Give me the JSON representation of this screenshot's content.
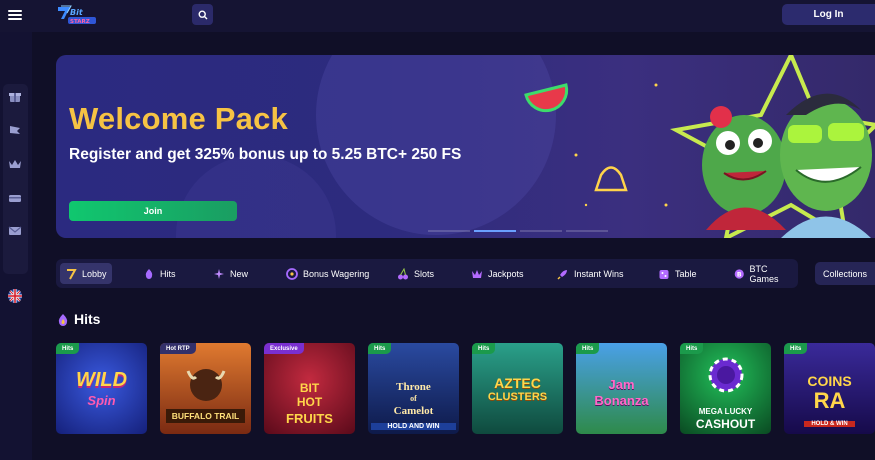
{
  "header": {
    "login_label": "Log In",
    "logo_alt": "Bit Starz logo"
  },
  "banner": {
    "title": "Welcome Pack",
    "subtitle": "Register and get 325% bonus up to 5.25 BTC+ 250 FS",
    "join_label": "Join",
    "active_slide": 2,
    "slide_count": 4
  },
  "categories": [
    {
      "label": "Lobby",
      "icon": "seven-icon",
      "active": true
    },
    {
      "label": "Hits",
      "icon": "flame-icon",
      "active": false
    },
    {
      "label": "New",
      "icon": "sparkle-icon",
      "active": false
    },
    {
      "label": "Bonus Wagering",
      "icon": "target-icon",
      "active": false
    },
    {
      "label": "Slots",
      "icon": "cherry-icon",
      "active": false
    },
    {
      "label": "Jackpots",
      "icon": "crown-icon",
      "active": false
    },
    {
      "label": "Instant Wins",
      "icon": "rocket-icon",
      "active": false
    },
    {
      "label": "Table",
      "icon": "dice-icon",
      "active": false
    },
    {
      "label": "BTC Games",
      "icon": "bitcoin-icon",
      "active": false
    }
  ],
  "collections_label": "Collections",
  "section": {
    "title": "Hits",
    "icon": "flame-icon"
  },
  "games": [
    {
      "badge": "Hits",
      "title": "Wild Spin",
      "art_text": [
        "WILD",
        "Spin"
      ],
      "bg": "#1b2a8c",
      "badge_color": "#1b9a4b"
    },
    {
      "badge": "Hot RTP",
      "title": "Buffalo Trail",
      "art_text": [
        "BUFFALO TRAIL"
      ],
      "bg": "#a34a22",
      "badge_color": "#33306a"
    },
    {
      "badge": "Exclusive",
      "title": "Bit Hot Fruits",
      "art_text": [
        "BIT",
        "HOT",
        "FRUITS"
      ],
      "bg": "#8a1730",
      "badge_color": "#7a2fd0"
    },
    {
      "badge": "Hits",
      "title": "Throne of Camelot",
      "art_text": [
        "Throne",
        "of",
        "Camelot",
        "HOLD AND WIN"
      ],
      "bg": "#17306e",
      "badge_color": "#1b9a4b"
    },
    {
      "badge": "Hits",
      "title": "Aztec Clusters",
      "art_text": [
        "AZTEC",
        "CLUSTERS"
      ],
      "bg": "#1f7a70",
      "badge_color": "#1b9a4b"
    },
    {
      "badge": "Hits",
      "title": "Jam Bonanza",
      "art_text": [
        "Jam",
        "Bonanza"
      ],
      "bg": "#2a7cc8",
      "badge_color": "#1b9a4b"
    },
    {
      "badge": "Hits",
      "title": "Mega Lucky Cashout",
      "art_text": [
        "MEGA LUCKY",
        "CASHOUT"
      ],
      "bg": "#0f7a3d",
      "badge_color": "#1b9a4b"
    },
    {
      "badge": "Hits",
      "title": "Coins of Ra",
      "art_text": [
        "COINS",
        "RA",
        "HOLD & WIN"
      ],
      "bg": "#2a1b6e",
      "badge_color": "#1b9a4b"
    }
  ],
  "colors": {
    "accent_yellow": "#f6c344",
    "join_green": "#10c76f",
    "background": "#100f27"
  }
}
